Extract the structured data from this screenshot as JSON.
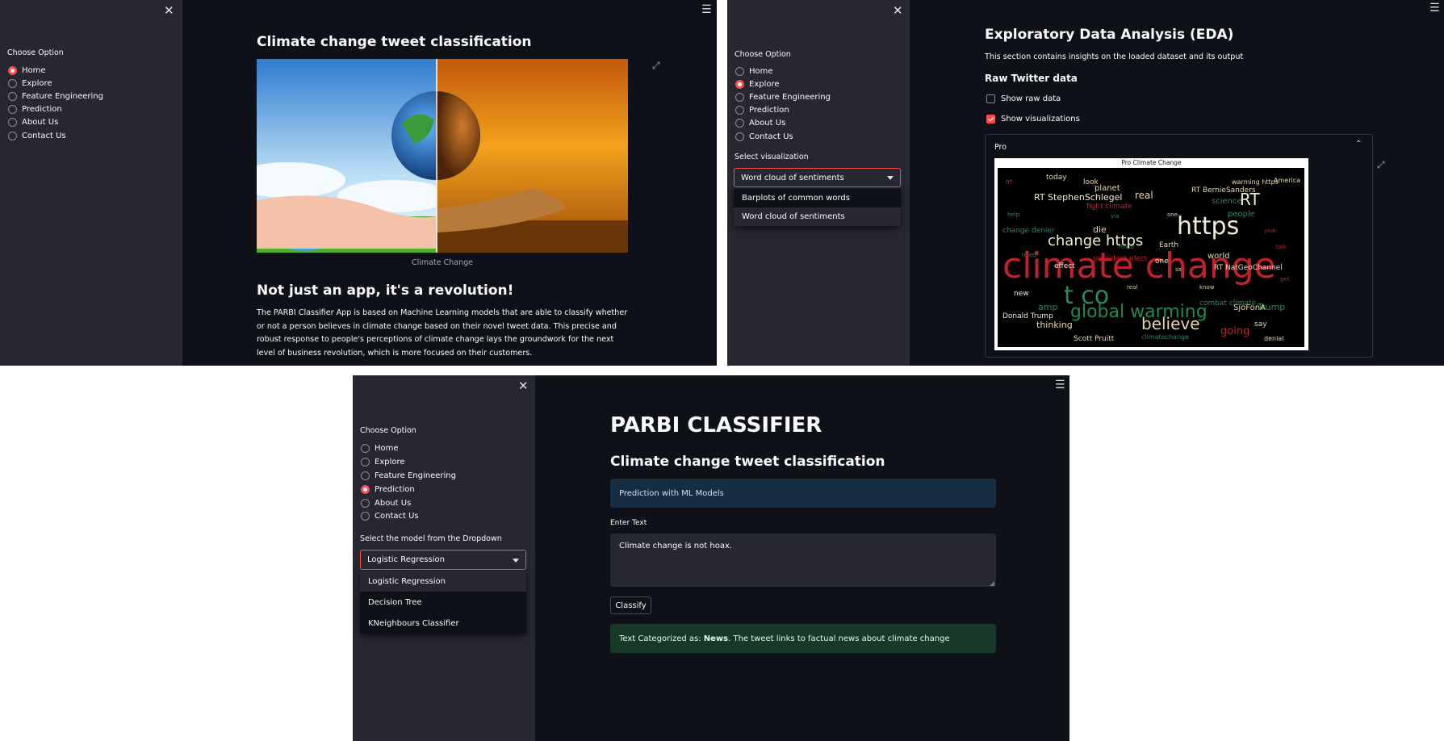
{
  "nav_options": [
    "Home",
    "Explore",
    "Feature Engineering",
    "Prediction",
    "About Us",
    "Contact Us"
  ],
  "icons": {
    "close": "close-icon",
    "menu": "hamburger-menu-icon",
    "expand": "expand-icon",
    "collapse": "chevron-up-icon",
    "dropdown": "chevron-down-icon"
  },
  "colors": {
    "accent": "#ff4b4b",
    "sidebar_bg": "#262730",
    "main_bg": "#0e1117",
    "info_bg": "#172d43",
    "success_bg": "#173928",
    "text": "#fafafa"
  },
  "panel_home": {
    "sidebar": {
      "choose_label": "Choose Option",
      "selected": "Home"
    },
    "title": "Climate change tweet classification",
    "image_caption": "Climate Change",
    "headline": "Not just an app, it's a revolution!",
    "paragraph": "The PARBI Classifier App is based on Machine Learning models that are able to classify whether or not a person believes in climate change based on their novel tweet data. This precise and robust response to people's perceptions of climate change lays the groundwork for the next level of business revolution, which is more focused on their customers."
  },
  "panel_explore": {
    "sidebar": {
      "choose_label": "Choose Option",
      "selected": "Explore",
      "select_label": "Select visualization",
      "select_value": "Word cloud of sentiments",
      "options": [
        "Barplots of common words",
        "Word cloud of sentiments"
      ]
    },
    "title": "Exploratory Data Analysis (EDA)",
    "subtitle": "This section contains insights on the loaded dataset and its output",
    "section_heading": "Raw Twitter data",
    "checkbox_raw": {
      "label": "Show raw data",
      "checked": false
    },
    "checkbox_vis": {
      "label": "Show visualizations",
      "checked": true
    },
    "expander_label": "Pro",
    "wordcloud_title": "Pro Climate Change",
    "wordcloud_words": [
      "climate change",
      "https",
      "global warming",
      "believe",
      "change https",
      "t co",
      "RT StephenSchlegel",
      "going",
      "thinking",
      "RT",
      "Trump",
      "people",
      "fight climate",
      "president elect",
      "change denier",
      "amp",
      "SjoFonA",
      "world",
      "science",
      "warming https",
      "RT BernieSanders",
      "America",
      "Earth",
      "real",
      "planet",
      "die",
      "Donald Trump",
      "RT NatGeoChannel",
      "combat climate",
      "denial",
      "climatechange",
      "Scott Pruitt",
      "today",
      "look",
      "say",
      "new",
      "one",
      "effect"
    ]
  },
  "panel_predict": {
    "sidebar": {
      "choose_label": "Choose Option",
      "selected": "Prediction",
      "select_label": "Select the model from the Dropdown",
      "select_value": "Logistic Regression",
      "options": [
        "Logistic Regression",
        "Decision Tree",
        "KNeighbours Classifier"
      ]
    },
    "title": "PARBI CLASSIFIER",
    "subtitle": "Climate change tweet classification",
    "info_text": "Prediction with ML Models",
    "input_label": "Enter Text",
    "input_value": "Climate change is not hoax.",
    "button_label": "Classify",
    "result_prefix": "Text Categorized as: ",
    "result_category": "News",
    "result_suffix": ". The tweet links to factual news about climate change"
  }
}
